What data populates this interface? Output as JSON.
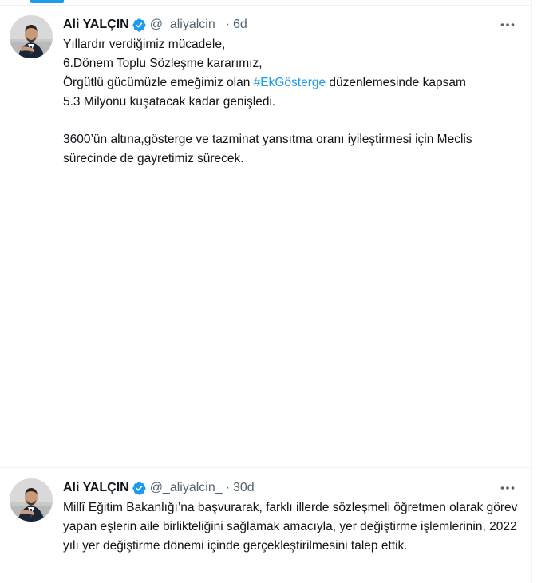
{
  "tweets": [
    {
      "author": {
        "name": "Ali YALÇIN",
        "handle": "@_aliyalcin_",
        "verified": true
      },
      "separator": "·",
      "time": "6d",
      "more_icon": "more-horizontal-icon",
      "text": {
        "line1": "Yıllardır verdiğimiz mücadele,",
        "line2": "6.Dönem Toplu Sözleşme kararımız,",
        "line3_before": "Örgütlü gücümüzle emeğimiz olan ",
        "hashtag": "#EkGösterge",
        "line3_after": " düzenlemesinde kapsam",
        "line4": "5.3 Milyonu kuşatacak kadar genişledi.",
        "paragraph2": "3600’ün altına,gösterge ve tazminat yansıtma oranı iyileştirmesi için Meclis sürecinde de gayretimiz sürecek."
      }
    },
    {
      "author": {
        "name": "Ali YALÇIN",
        "handle": "@_aliyalcin_",
        "verified": true
      },
      "separator": "·",
      "time": "30d",
      "more_icon": "more-horizontal-icon",
      "text": {
        "paragraph1": "Millî Eğitim Bakanlığı’na başvurarak, farklı illerde sözleşmeli öğretmen olarak görev yapan eşlerin aile birlikteliğini sağlamak amacıyla, yer değiştirme işlemlerinin, 2022 yılı yer değiştirme dönemi içinde gerçekleştirilmesini talep ettik."
      }
    }
  ],
  "colors": {
    "accent": "#1d9bf0",
    "text": "#0f1419",
    "secondary": "#536471",
    "border": "#eff3f4"
  }
}
